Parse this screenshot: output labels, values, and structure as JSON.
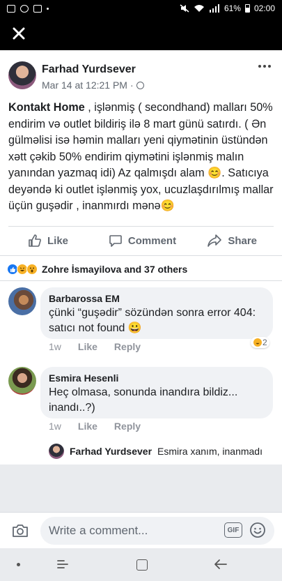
{
  "status_bar": {
    "battery": "61%",
    "time": "02:00"
  },
  "post": {
    "author": "Farhad Yurdsever",
    "timestamp": "Mar 14 at 12:21 PM",
    "meta_separator": "·",
    "text_bold": "Kontakt Home",
    "text_body": " , işlənmiş ( secondhand) malları 50% endirim və outlet bildiriş ilə 8 mart günü satırdı. ( Ən gülməlisi isə həmin malları yeni qiymətinin üstündən xətt çəkib 50% endirim qiymətini  işlənmiş malın yanından yazmaq idi) Az qalmışdı alam 😊. Satıcıya deyəndə  ki outlet işlənmiş yox, ucuzlaşdırılmış mallar üçün guşədir , inanmırdı mənə😊",
    "actions": {
      "like": "Like",
      "comment": "Comment",
      "share": "Share"
    }
  },
  "reactions": {
    "summary": "Zohre İsmayilova and 37 others"
  },
  "comments": [
    {
      "author": "Barbarossa EM",
      "text": "çünki “guşədir” sözündən sonra error 404: satıcı not found 😀",
      "time": "1w",
      "like": "Like",
      "reply": "Reply",
      "reaction_count": "2"
    },
    {
      "author": "Esmira  Hesenli",
      "text": "Heç olmasa, sonunda inandıra bildiz... inandı..?)",
      "time": "1w",
      "like": "Like",
      "reply": "Reply"
    }
  ],
  "reply": {
    "author": "Farhad Yurdsever",
    "text": "Esmira xanım, inanmadı"
  },
  "compose": {
    "placeholder": "Write a comment...",
    "gif_label": "GIF"
  },
  "colors": {
    "accent": "#1877f2",
    "bubble": "#f0f2f5",
    "secondary_text": "#606770"
  },
  "icons": [
    "close-icon",
    "more-icon",
    "globe-icon",
    "like-icon",
    "comment-icon",
    "share-icon",
    "camera-icon",
    "gif-icon",
    "emoji-icon"
  ]
}
